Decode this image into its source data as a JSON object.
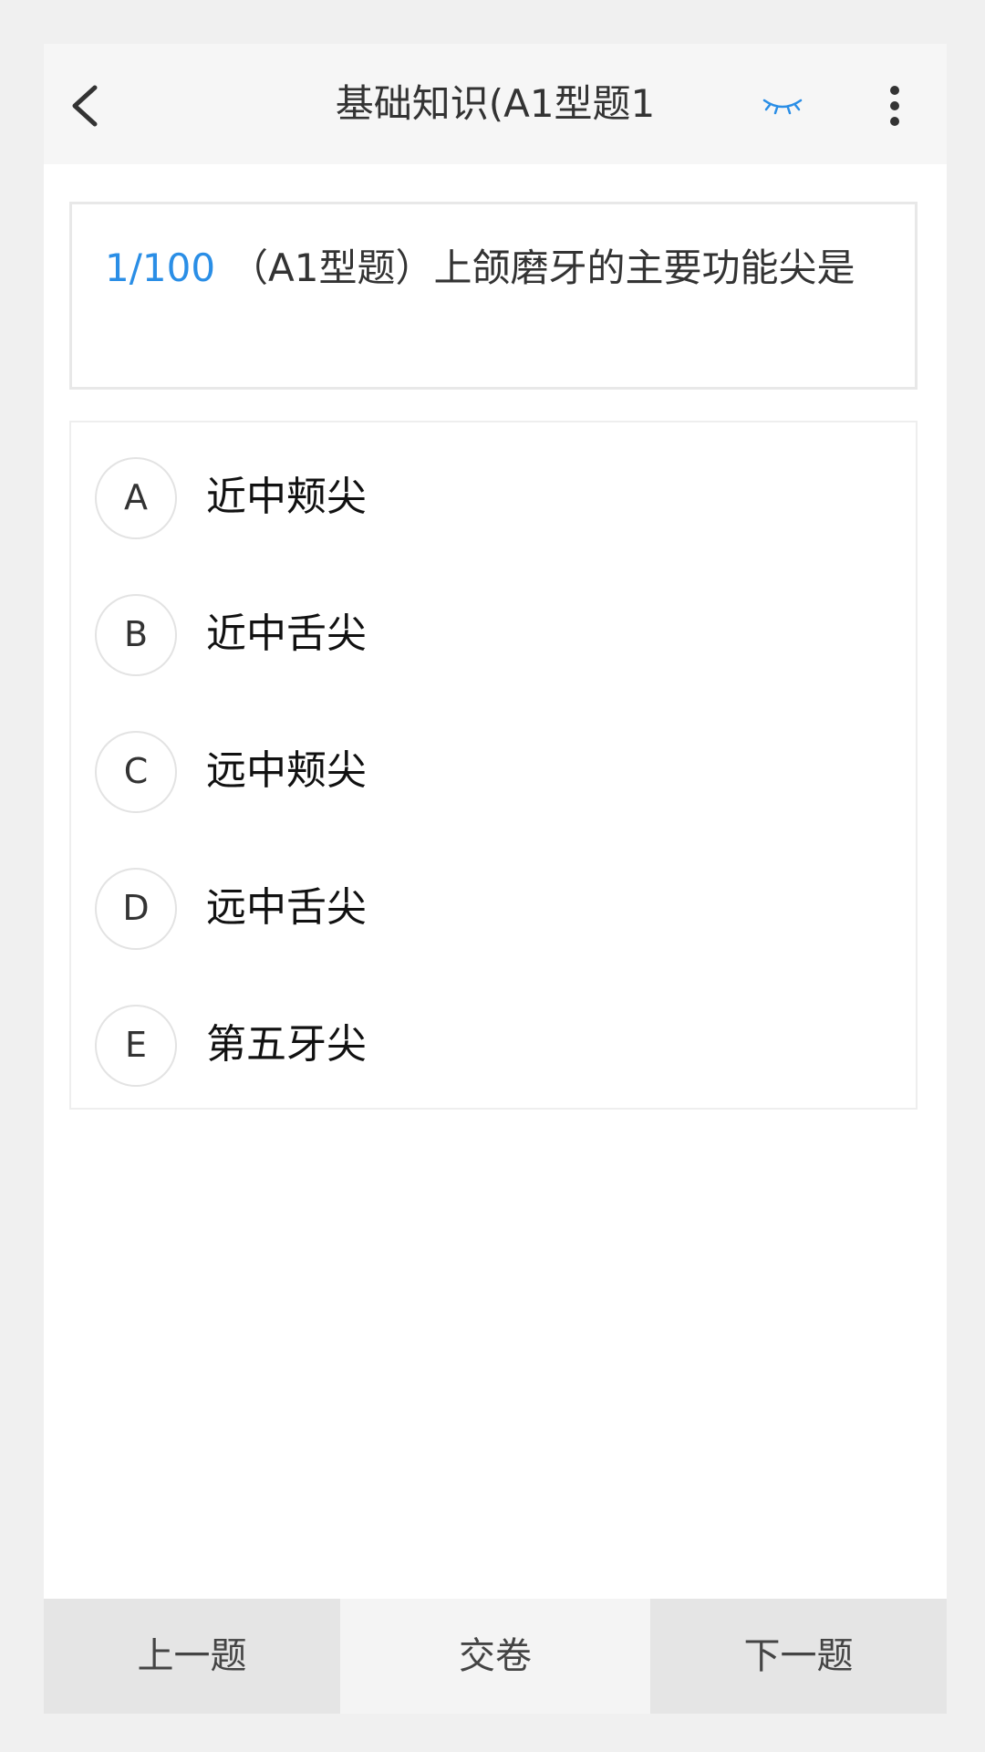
{
  "header": {
    "title": "基础知识(A1型题1",
    "back_icon": "chevron-left-icon",
    "eye_icon": "eye-closed-icon",
    "more_icon": "more-vertical-icon",
    "accent_color": "#2a8ee6"
  },
  "question": {
    "number": "1/100",
    "text": "（A1型题）上颌磨牙的主要功能尖是"
  },
  "options": [
    {
      "letter": "A",
      "text": "近中颊尖"
    },
    {
      "letter": "B",
      "text": "近中舌尖"
    },
    {
      "letter": "C",
      "text": "远中颊尖"
    },
    {
      "letter": "D",
      "text": "远中舌尖"
    },
    {
      "letter": "E",
      "text": "第五牙尖"
    }
  ],
  "bottom_bar": {
    "prev_label": "上一题",
    "submit_label": "交卷",
    "next_label": "下一题"
  }
}
